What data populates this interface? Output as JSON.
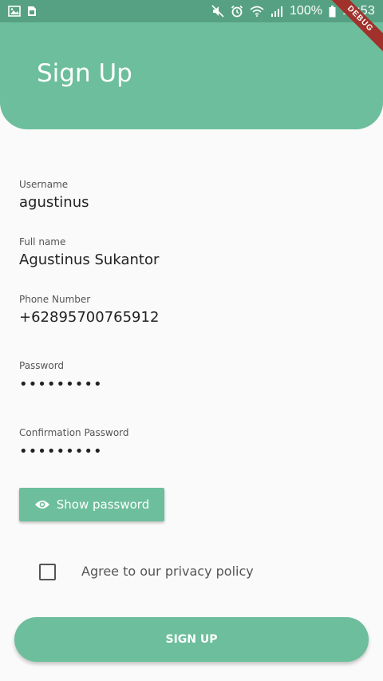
{
  "status_bar": {
    "battery_percent": "100%",
    "time": "15:53",
    "icons": [
      "image-icon",
      "sim-icon",
      "mute-icon",
      "alarm-icon",
      "wifi-icon",
      "signal-icon",
      "battery-icon"
    ]
  },
  "debug_banner": "DEBUG",
  "header": {
    "title": "Sign Up"
  },
  "form": {
    "username": {
      "label": "Username",
      "value": "agustinus"
    },
    "full_name": {
      "label": "Full name",
      "value": "Agustinus Sukantor"
    },
    "phone": {
      "label": "Phone Number",
      "value": "+62895700765912"
    },
    "password": {
      "label": "Password",
      "value": "•••••••••"
    },
    "confirm_password": {
      "label": "Confirmation Password",
      "value": "•••••••••"
    }
  },
  "show_password_button": {
    "label": "Show password",
    "icon": "eye-icon"
  },
  "privacy": {
    "label": "Agree to our privacy policy",
    "checked": false
  },
  "signup_button": {
    "label": "SIGN UP"
  },
  "colors": {
    "primary": "#6cbe9c",
    "status_bar": "#56a183",
    "ribbon": "#a0312b"
  }
}
